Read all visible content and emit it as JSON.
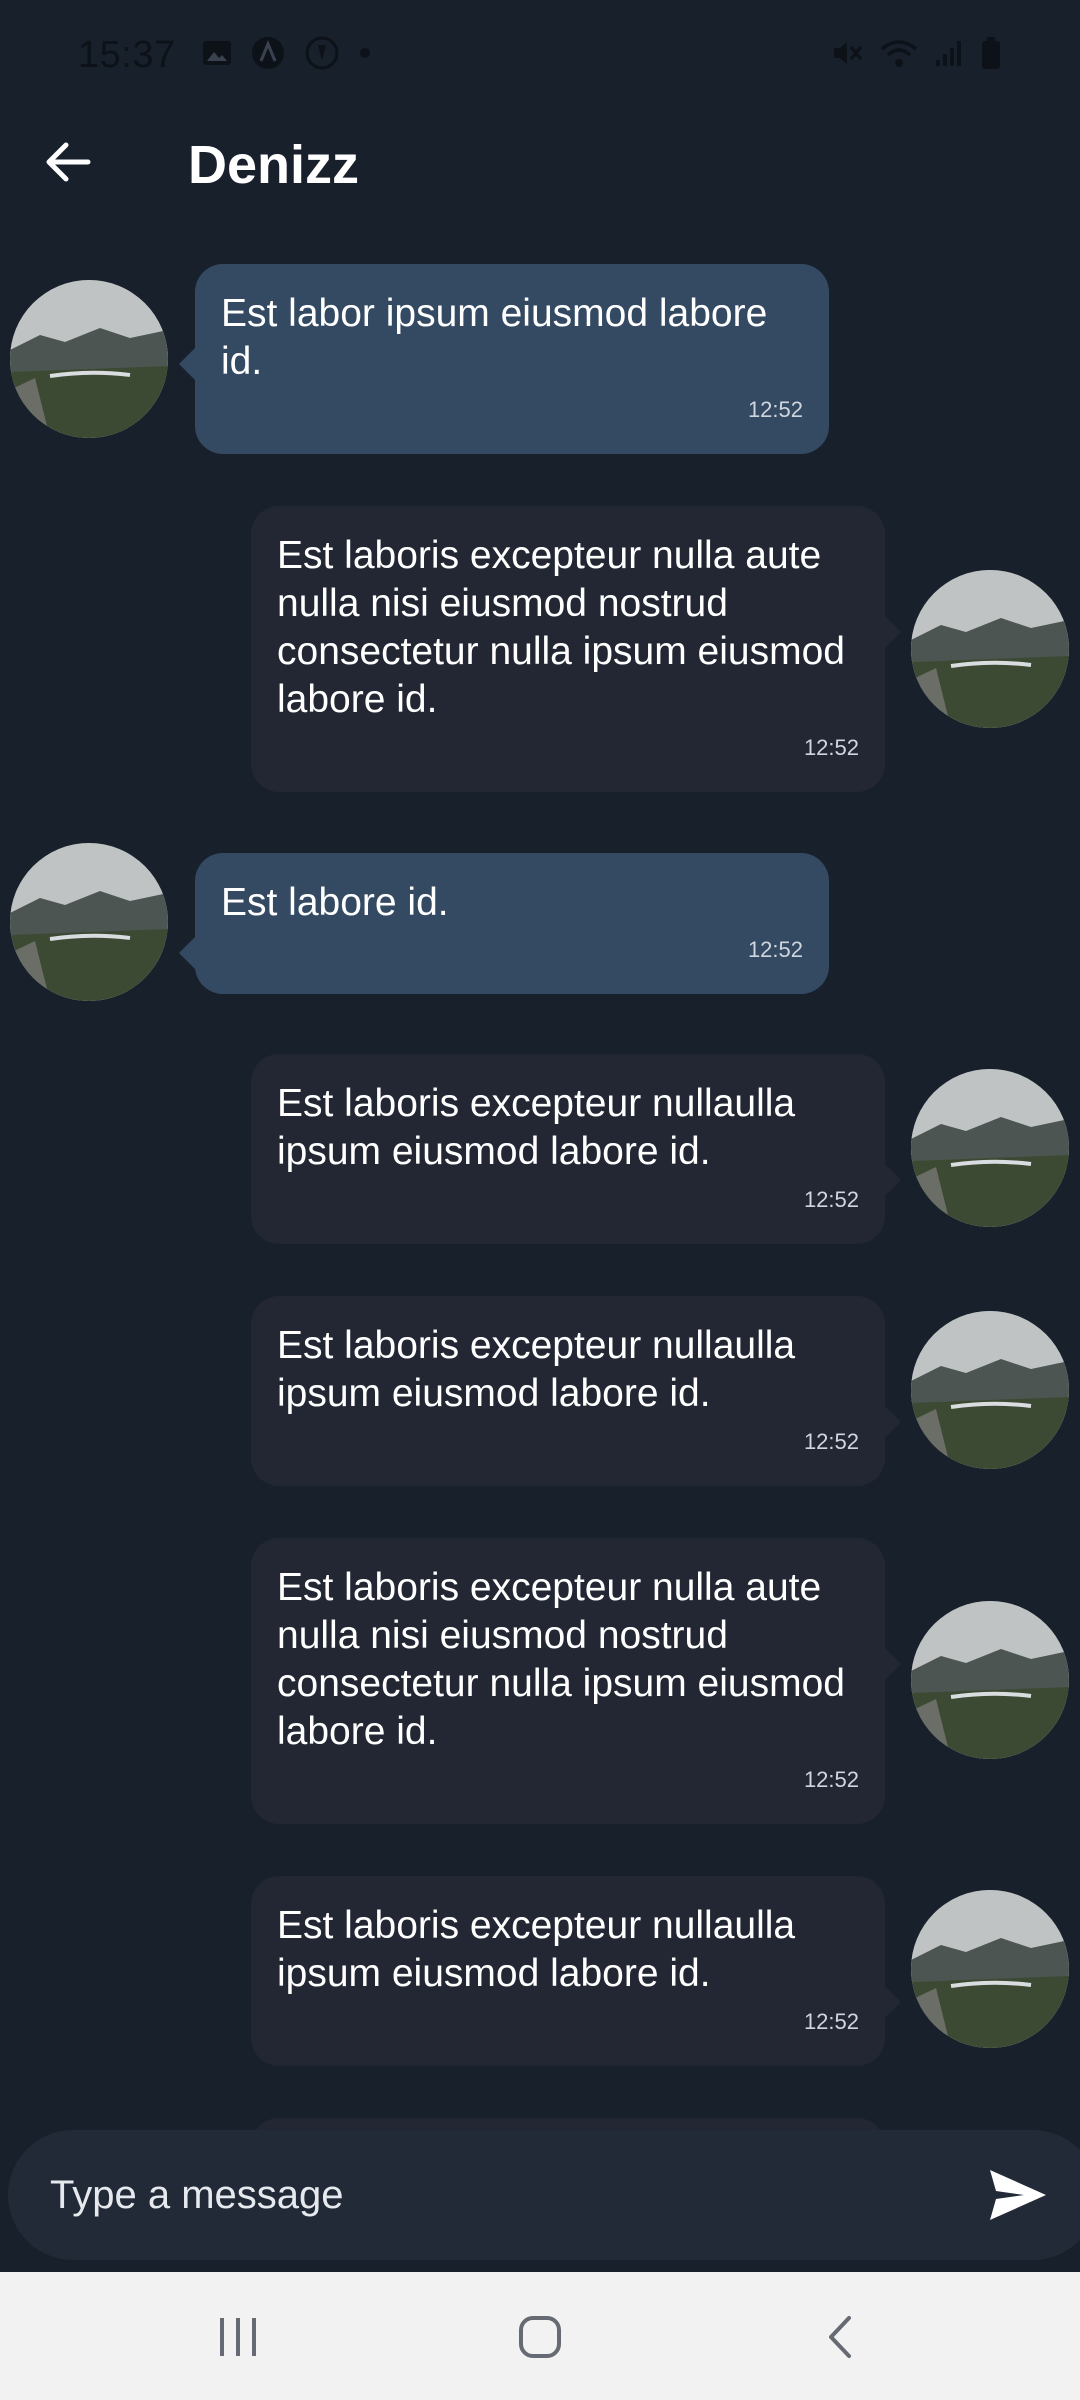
{
  "status_bar": {
    "time": "15:37",
    "left_icons": [
      "gallery-icon",
      "app-a-icon",
      "app-b-icon",
      "dot-icon"
    ],
    "right_icons": [
      "mute-icon",
      "wifi-icon",
      "signal-icon",
      "battery-icon"
    ]
  },
  "header": {
    "title": "Denizz",
    "back_icon": "arrow-left-icon"
  },
  "messages": [
    {
      "direction": "incoming",
      "text": "Est labor ipsum eiusmod labore id.",
      "time": "12:52"
    },
    {
      "direction": "outgoing",
      "text": "Est laboris excepteur nulla aute nulla nisi eiusmod nostrud consectetur nulla ipsum eiusmod labore id.",
      "time": "12:52"
    },
    {
      "direction": "incoming",
      "text": "Est labore id.",
      "time": "12:52"
    },
    {
      "direction": "outgoing",
      "text": "Est laboris excepteur nullaulla ipsum eiusmod labore id.",
      "time": "12:52"
    },
    {
      "direction": "outgoing",
      "text": "Est laboris excepteur nullaulla ipsum eiusmod labore id.",
      "time": "12:52"
    },
    {
      "direction": "outgoing",
      "text": "Est laboris excepteur nulla aute nulla nisi eiusmod nostrud consectetur nulla ipsum eiusmod labore id.",
      "time": "12:52"
    },
    {
      "direction": "outgoing",
      "text": "Est laboris excepteur nullaulla ipsum eiusmod labore id.",
      "time": "12:52"
    }
  ],
  "composer": {
    "placeholder": "Type a message",
    "value": "",
    "send_icon": "send-icon"
  },
  "nav_bar": {
    "buttons": [
      "recent-apps-icon",
      "home-icon",
      "back-icon"
    ]
  },
  "colors": {
    "background": "#18202b",
    "incoming_bubble": "#344a63",
    "outgoing_bubble": "#222733",
    "input_bar": "#222a37",
    "nav_bar": "#f2f2f2"
  }
}
